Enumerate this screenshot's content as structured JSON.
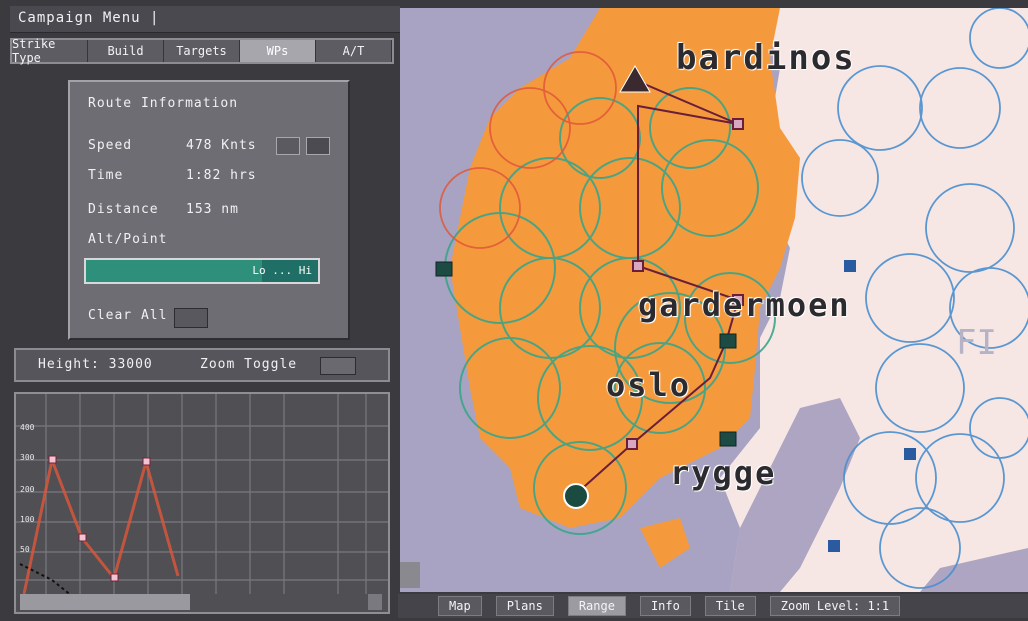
{
  "window_title": "Campaign Menu |",
  "tabs": [
    {
      "label": "Strike Type"
    },
    {
      "label": "Build"
    },
    {
      "label": "Targets"
    },
    {
      "label": "WPs"
    },
    {
      "label": "A/T"
    }
  ],
  "active_tab_index": 3,
  "route_info": {
    "heading": "Route Information",
    "speed_label": "Speed",
    "speed_value": "478 Knts",
    "time_label": "Time",
    "time_value": "1:82 hrs",
    "distance_label": "Distance",
    "distance_value": "153 nm",
    "alt_label": "Alt/Point",
    "alt_bar_text": "Lo ... Hi",
    "alt_fraction": 0.76,
    "clear_label": "Clear All"
  },
  "height_label": "Height: 33000",
  "zoom_label": "Zoom Toggle",
  "profile": {
    "y_ticks": [
      "400",
      "300",
      "200",
      "100",
      "50"
    ]
  },
  "map_labels": {
    "bardufoss": "bardinos",
    "gardermoen": "gardermoen",
    "oslo": "oslo",
    "rygge": "rygge"
  },
  "bottom_buttons": [
    {
      "label": "Map"
    },
    {
      "label": "Plans"
    },
    {
      "label": "Range"
    },
    {
      "label": "Info"
    },
    {
      "label": "Tile"
    },
    {
      "label": "Zoom Level: 1:1"
    }
  ],
  "active_bottom_index": 2,
  "colors": {
    "land_orange": "#f59a3c",
    "sea_lavender": "#a8a3c2",
    "snow": "#f7e7e4",
    "waypoint": "#8a2050",
    "range_green": "#3aa58a",
    "range_blue": "#4a8fd0"
  }
}
